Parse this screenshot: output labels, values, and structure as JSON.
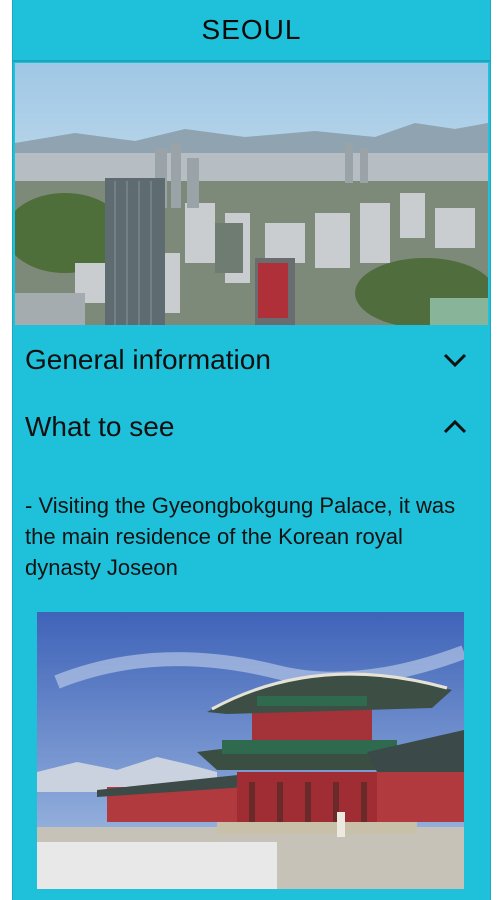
{
  "header": {
    "title": "SEOUL"
  },
  "sections": [
    {
      "label": "General information",
      "icon": "chevron-down-icon",
      "expanded": false
    },
    {
      "label": "What to see",
      "icon": "chevron-up-icon",
      "expanded": true
    }
  ],
  "content": {
    "description": "- Visiting the Gyeongbokgung Palace, it was the main residence of the Korean royal dynasty Joseon"
  },
  "colors": {
    "background": "#1ec0da",
    "text": "#101010"
  }
}
